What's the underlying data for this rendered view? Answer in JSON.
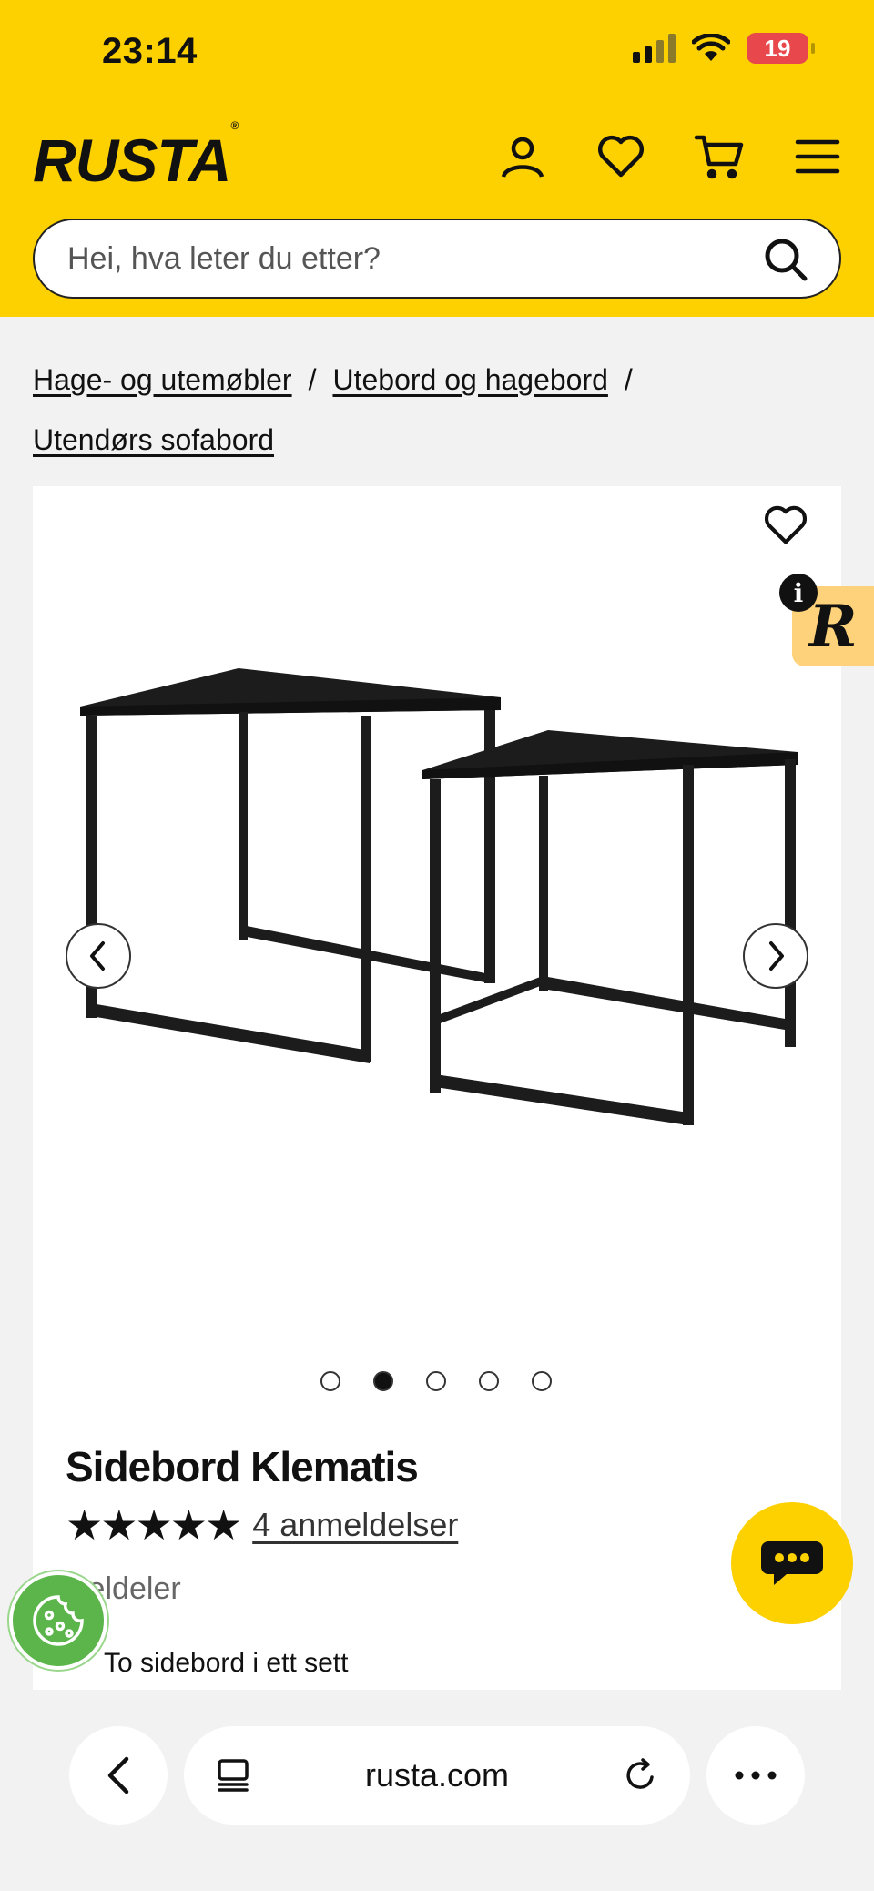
{
  "status_bar": {
    "time": "23:14",
    "battery": "19"
  },
  "header": {
    "logo": "RUSTA",
    "logo_mark": "®",
    "icons": [
      "user-icon",
      "heart-icon",
      "cart-icon",
      "menu-icon"
    ],
    "brand_color": "#fdd000"
  },
  "search": {
    "placeholder": "Hei, hva leter du etter?"
  },
  "breadcrumb": {
    "items": [
      "Hage- og utemøbler",
      "Utebord og hagebord",
      "Utendørs sofabord"
    ],
    "separator": "/"
  },
  "gallery": {
    "active_index": 1,
    "total": 5
  },
  "product": {
    "title": "Sidebord Klematis",
    "stars": "★★★★★",
    "rating": 5,
    "reviews": "4 anmeldelser",
    "share_label": "Del",
    "share_suffix": "deler",
    "bullet": "To sidebord i ett sett"
  },
  "badges": {
    "r_badge": "R",
    "info_badge": "i"
  },
  "browser": {
    "url": "rusta.com"
  }
}
